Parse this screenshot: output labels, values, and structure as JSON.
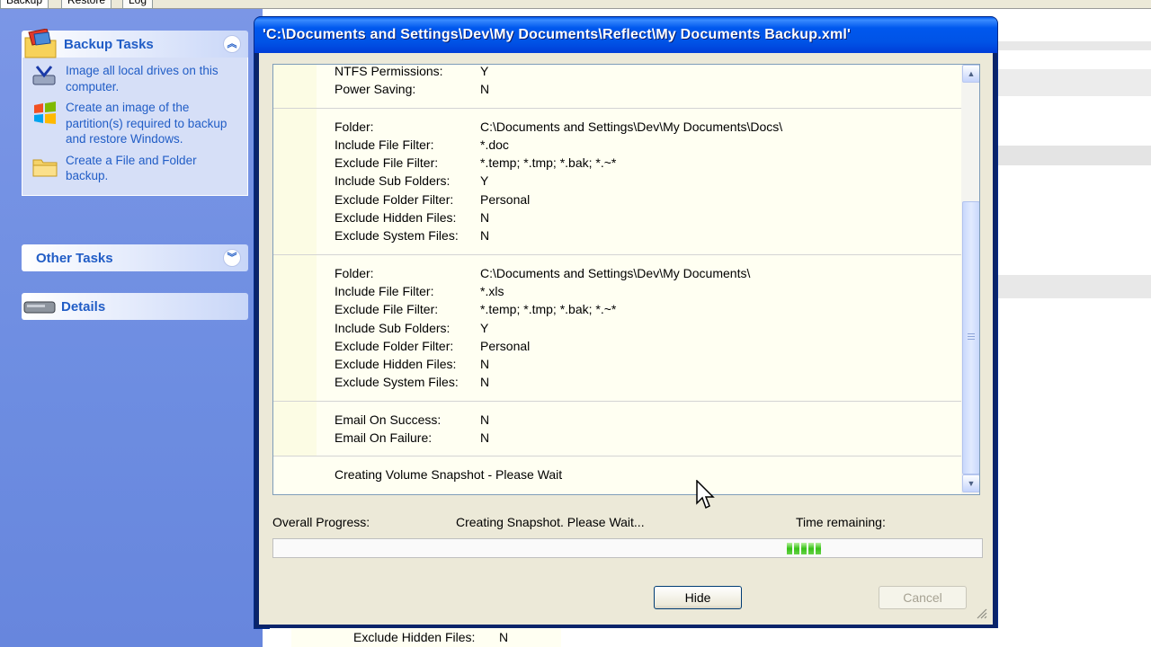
{
  "app": {
    "tabs": [
      "Backup",
      "Restore",
      "Log"
    ]
  },
  "sidebar": {
    "backup_tasks": {
      "title": "Backup Tasks",
      "items": [
        {
          "label": "Image all local drives on this computer.",
          "icon": "drives-icon"
        },
        {
          "label": "Create an image of the partition(s) required to backup and restore Windows.",
          "icon": "windows-flag-icon"
        },
        {
          "label": "Create a File and Folder backup.",
          "icon": "folder-icon"
        }
      ]
    },
    "other_tasks": {
      "title": "Other Tasks"
    },
    "details": {
      "title": "Details"
    }
  },
  "dialog": {
    "title": "'C:\\Documents and Settings\\Dev\\My Documents\\Reflect\\My Documents Backup.xml'",
    "log": {
      "top_block": [
        {
          "k": "NTFS Permissions:",
          "v": "Y"
        },
        {
          "k": "Power Saving:",
          "v": "N"
        }
      ],
      "folder_block_1": [
        {
          "k": "Folder:",
          "v": "C:\\Documents and Settings\\Dev\\My Documents\\Docs\\"
        },
        {
          "k": "Include File Filter:",
          "v": "*.doc"
        },
        {
          "k": "Exclude File Filter:",
          "v": "*.temp; *.tmp; *.bak; *.~*"
        },
        {
          "k": "Include Sub Folders:",
          "v": "Y"
        },
        {
          "k": "Exclude Folder Filter:",
          "v": "Personal"
        },
        {
          "k": "Exclude Hidden Files:",
          "v": "N"
        },
        {
          "k": "Exclude System Files:",
          "v": "N"
        }
      ],
      "folder_block_2": [
        {
          "k": "Folder:",
          "v": "C:\\Documents and Settings\\Dev\\My Documents\\"
        },
        {
          "k": "Include File Filter:",
          "v": "*.xls"
        },
        {
          "k": "Exclude File Filter:",
          "v": "*.temp; *.tmp; *.bak; *.~*"
        },
        {
          "k": "Include Sub Folders:",
          "v": "Y"
        },
        {
          "k": "Exclude Folder Filter:",
          "v": "Personal"
        },
        {
          "k": "Exclude Hidden Files:",
          "v": "N"
        },
        {
          "k": "Exclude System Files:",
          "v": "N"
        }
      ],
      "email_block": [
        {
          "k": "Email On Success:",
          "v": "N"
        },
        {
          "k": "Email On Failure:",
          "v": "N"
        }
      ],
      "status": "Creating Volume Snapshot - Please Wait"
    },
    "progress": {
      "label": "Overall Progress:",
      "status": "Creating Snapshot. Please Wait...",
      "time_label": "Time remaining:",
      "fill_start_percent": 72.5,
      "chunk_count": 5
    },
    "buttons": {
      "hide": "Hide",
      "cancel": "Cancel"
    }
  },
  "background_row": {
    "k": "Exclude Hidden Files:",
    "v": "N"
  }
}
